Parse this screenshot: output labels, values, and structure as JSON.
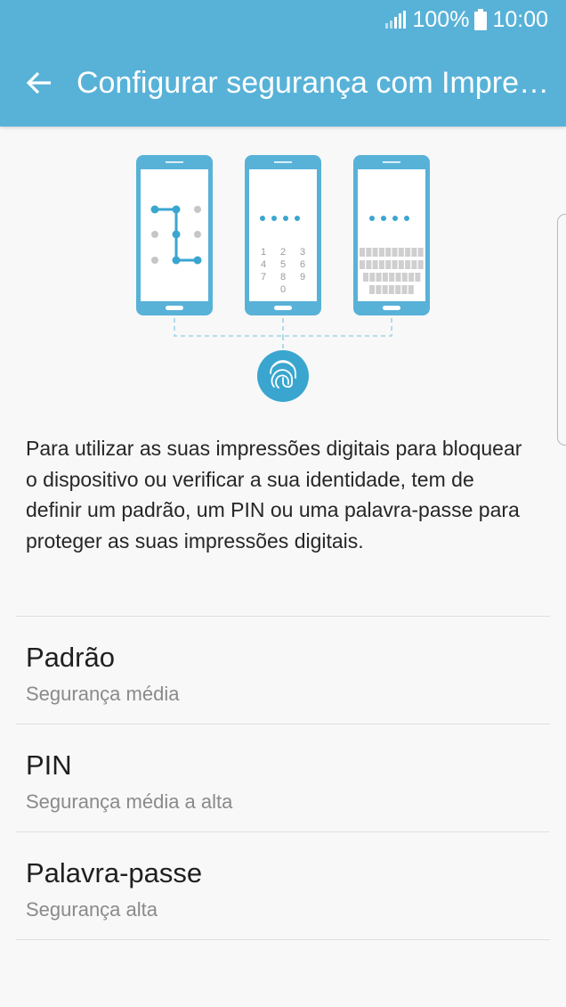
{
  "status_bar": {
    "battery": "100%",
    "time": "10:00",
    "signal_icon": "signal-icon",
    "battery_icon": "battery-icon"
  },
  "app_bar": {
    "back_icon": "arrow-left-icon",
    "title": "Configurar segurança com Impressões digitais"
  },
  "illustration": {
    "pin_keys": [
      "1",
      "2",
      "3",
      "4",
      "5",
      "6",
      "7",
      "8",
      "9",
      "0"
    ],
    "fingerprint_icon": "fingerprint-icon"
  },
  "description": "Para utilizar as suas impressões digitais para bloquear o dispositivo ou verificar a sua identidade, tem de definir um padrão, um PIN ou uma palavra-passe para proteger as suas impressões digitais.",
  "options": [
    {
      "title": "Padrão",
      "subtitle": "Segurança média"
    },
    {
      "title": "PIN",
      "subtitle": "Segurança média a alta"
    },
    {
      "title": "Palavra-passe",
      "subtitle": "Segurança alta"
    }
  ],
  "colors": {
    "header": "#58b2d8",
    "accent": "#3aa6cf",
    "background": "#f8f8f8"
  }
}
